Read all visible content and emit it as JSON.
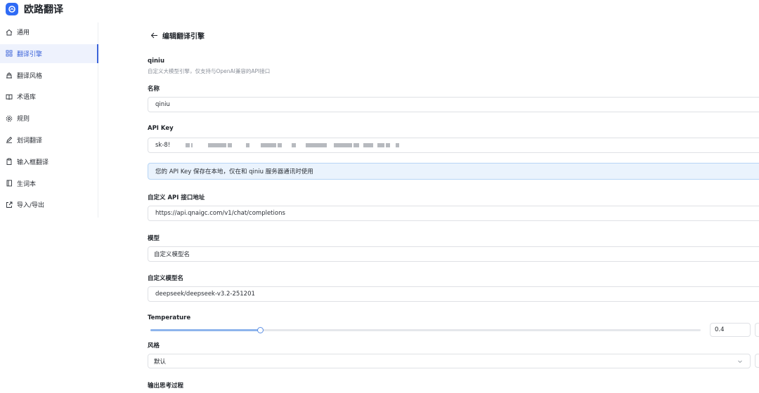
{
  "app": {
    "title": "欧路翻译"
  },
  "sidebar": {
    "items": [
      {
        "label": "通用",
        "icon": "home-icon"
      },
      {
        "label": "翻译引擎",
        "icon": "grid-icon"
      },
      {
        "label": "翻译风格",
        "icon": "style-icon"
      },
      {
        "label": "术语库",
        "icon": "book-icon"
      },
      {
        "label": "规则",
        "icon": "gear-icon"
      },
      {
        "label": "划词翻译",
        "icon": "pen-icon"
      },
      {
        "label": "输入框翻译",
        "icon": "clipboard-icon"
      },
      {
        "label": "生词本",
        "icon": "notebook-icon"
      },
      {
        "label": "导入/导出",
        "icon": "export-icon"
      }
    ],
    "active_index": 1
  },
  "page": {
    "title": "编辑翻译引擎"
  },
  "engine": {
    "name": "qiniu",
    "description": "自定义大模型引擎，仅支持与OpenAI兼容的API接口"
  },
  "form": {
    "name_label": "名称",
    "name_value": "qiniu",
    "api_key_label": "API Key",
    "api_key_prefix": "sk-8!",
    "api_key_notice": "您的 API Key 保存在本地，仅在和 qiniu 服务器通讯时使用",
    "endpoint_label": "自定义 API 接口地址",
    "endpoint_value": "https://api.qnaigc.com/v1/chat/completions",
    "model_label": "模型",
    "model_value": "自定义模型名",
    "custom_model_label": "自定义模型名",
    "custom_model_value": "deepseek/deepseek-v3.2-251201",
    "temperature_label": "Temperature",
    "temperature_value": "0.4",
    "temperature_fraction": 0.2,
    "style_label": "风格",
    "style_value": "默认",
    "thinking_label": "输出思考过程"
  },
  "colors": {
    "accent": "#3b63d9",
    "notice_bg": "#eaf3fd",
    "slider": "#5b8fe4"
  }
}
